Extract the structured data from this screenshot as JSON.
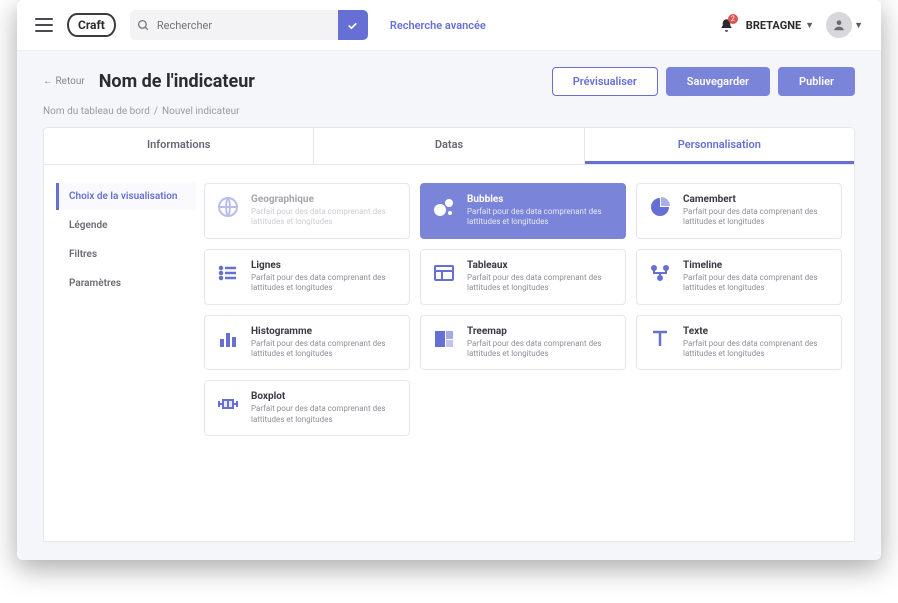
{
  "topbar": {
    "search_placeholder": "Rechercher",
    "advanced_search": "Recherche avancée",
    "region": "BRETAGNE",
    "bell_count": "2"
  },
  "header": {
    "back": "← Retour",
    "title": "Nom de l'indicateur",
    "preview": "Prévisualiser",
    "save": "Sauvegarder",
    "publish": "Publier"
  },
  "breadcrumb": {
    "root": "Nom du tableau de bord",
    "current": "Nouvel indicateur"
  },
  "tabs": {
    "info": "Informations",
    "data": "Datas",
    "perso": "Personnalisation"
  },
  "sidenav": {
    "viz": "Choix de la visualisation",
    "legend": "Légende",
    "filters": "Filtres",
    "params": "Paramètres"
  },
  "cards": {
    "desc": "Parfait pour des data comprenant des lattitudes et longitudes",
    "geo": "Geographique",
    "bubbles": "Bubbles",
    "camembert": "Camembert",
    "lignes": "Lignes",
    "tableaux": "Tableaux",
    "timeline": "Timeline",
    "histogramme": "Histogramme",
    "treemap": "Treemap",
    "texte": "Texte",
    "boxplot": "Boxplot"
  }
}
